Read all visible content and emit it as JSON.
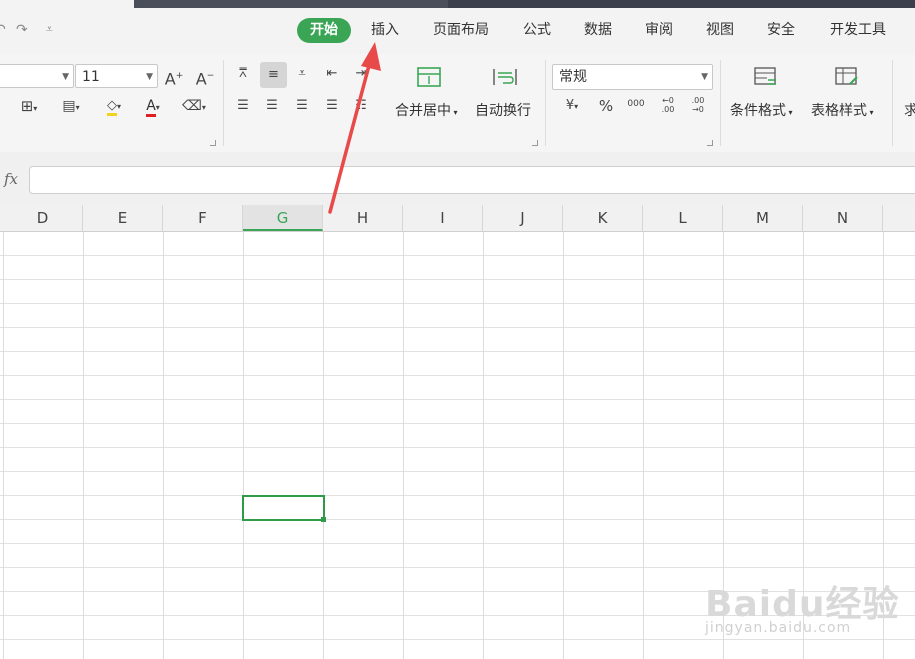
{
  "quick_access": {
    "redo_glyph": "↷",
    "customize_glyph": "⩡"
  },
  "tabs": [
    "开始",
    "插入",
    "页面布局",
    "公式",
    "数据",
    "审阅",
    "视图",
    "安全",
    "开发工具"
  ],
  "active_tab": "开始",
  "ribbon": {
    "font_size": "11",
    "grow_font": "A",
    "shrink_font": "A",
    "font_color_glyph": "A",
    "merge_center_label": "合并居中",
    "wrap_text_label": "自动换行",
    "number_format": "常规",
    "currency_glyph": "¥",
    "percent_glyph": "%",
    "thousands_glyph": "000",
    "increase_decimal": "←0 .00",
    "decrease_decimal": ".00 →0",
    "conditional_format_label": "条件格式",
    "table_style_label": "表格样式",
    "partial_label": "求"
  },
  "formula_bar": {
    "fx": "fx",
    "value": ""
  },
  "columns": [
    "D",
    "E",
    "F",
    "G",
    "H",
    "I",
    "J",
    "K",
    "L",
    "M",
    "N"
  ],
  "selected_column": "G",
  "watermark": {
    "text": "Baidu经验",
    "url": "jingyan.baidu.com"
  },
  "colors": {
    "accent": "#3aa655",
    "arrow": "#e84a4a"
  }
}
